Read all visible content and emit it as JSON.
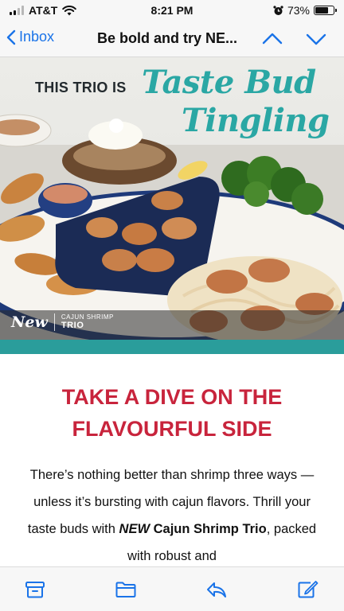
{
  "status_bar": {
    "carrier": "AT&T",
    "time": "8:21 PM",
    "battery": "73%",
    "battery_level": 0.73
  },
  "nav": {
    "back_label": "Inbox",
    "title": "Be bold and try NE..."
  },
  "hero": {
    "headline": "THIS TRIO IS",
    "script_line1": "Taste Bud",
    "script_line2": "Tingling",
    "badge_new": "New",
    "badge_small": "CAJUN SHRIMP",
    "badge_big": "TRIO"
  },
  "article": {
    "headline_line1": "TAKE A DIVE ON THE",
    "headline_line2": "FLAVOURFUL SIDE",
    "body_part1": "There’s nothing better than shrimp three ways — unless it’s bursting with cajun flavors. Thrill your taste buds with ",
    "body_bold_italic": "NEW",
    "body_bold": "Cajun Shrimp Trio",
    "body_part2": ", packed with robust and"
  },
  "toolbar": {
    "icons": [
      "archive-icon",
      "folder-icon",
      "reply-icon",
      "compose-icon"
    ]
  },
  "colors": {
    "accent_blue": "#1a73e8",
    "headline_red": "#c8243c",
    "script_teal": "#2aa7a4"
  }
}
